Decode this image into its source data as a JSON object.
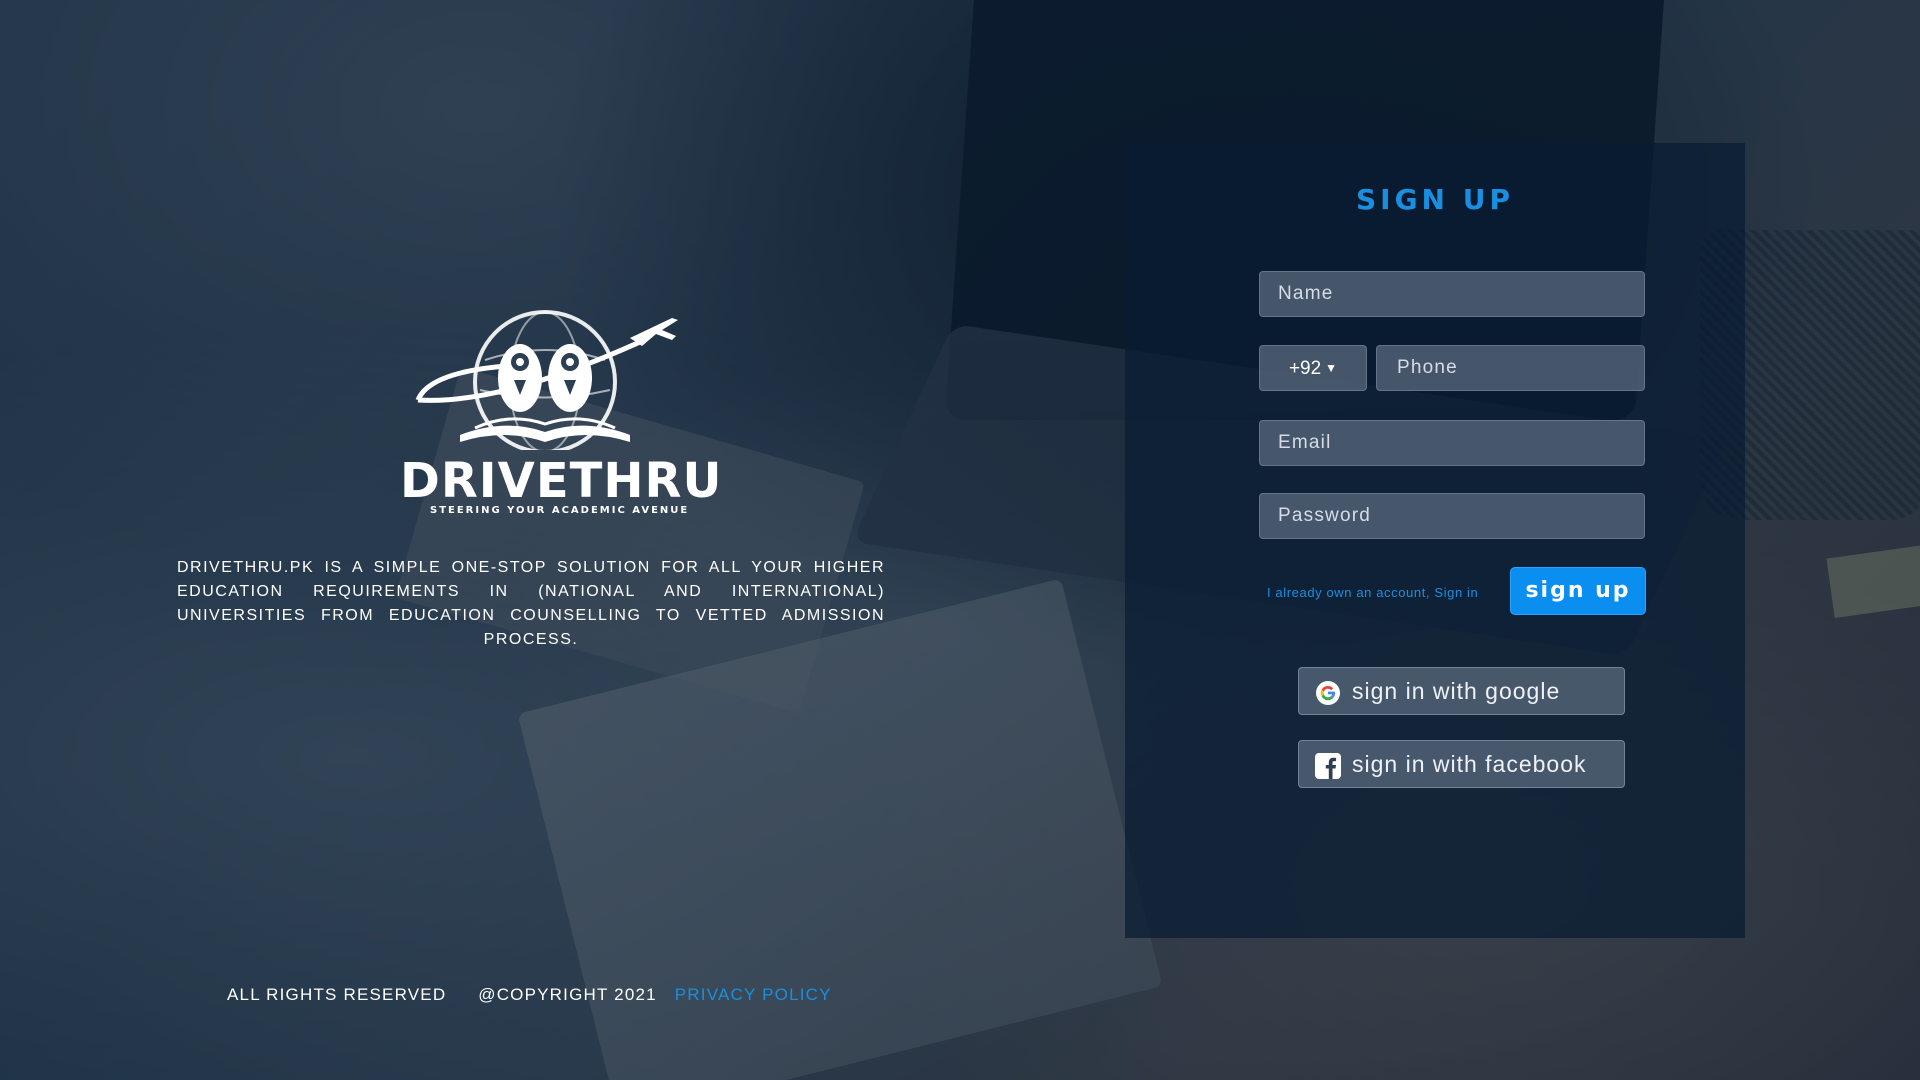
{
  "brand": {
    "name": "DRIVETHRU",
    "tagline": "STEERING YOUR ACADEMIC AVENUE",
    "description": "DRIVETHRU.PK IS A SIMPLE ONE-STOP SOLUTION FOR ALL YOUR HIGHER EDUCATION REQUIREMENTS IN (NATIONAL AND INTERNATIONAL) UNIVERSITIES FROM EDUCATION COUNSELLING TO VETTED ADMISSION PROCESS."
  },
  "footer": {
    "rights": "ALL RIGHTS RESERVED",
    "copyright": "@COPYRIGHT 2021",
    "privacy": "PRIVACY POLICY"
  },
  "signup": {
    "title": "SIGN UP",
    "name_placeholder": "Name",
    "country_code": "+92",
    "phone_placeholder": "Phone",
    "email_placeholder": "Email",
    "password_placeholder": "Password",
    "signin_link": "I already own an account, Sign in",
    "submit_label": "sign up",
    "google_label": "sign in with google",
    "facebook_label": "sign in with facebook"
  },
  "icons": {
    "country_code_caret": "caret-down-icon",
    "google": "google-icon",
    "facebook": "facebook-icon"
  },
  "colors": {
    "accent": "#1a8fe0",
    "button": "#0a8ef0",
    "panel": "#081c32"
  }
}
